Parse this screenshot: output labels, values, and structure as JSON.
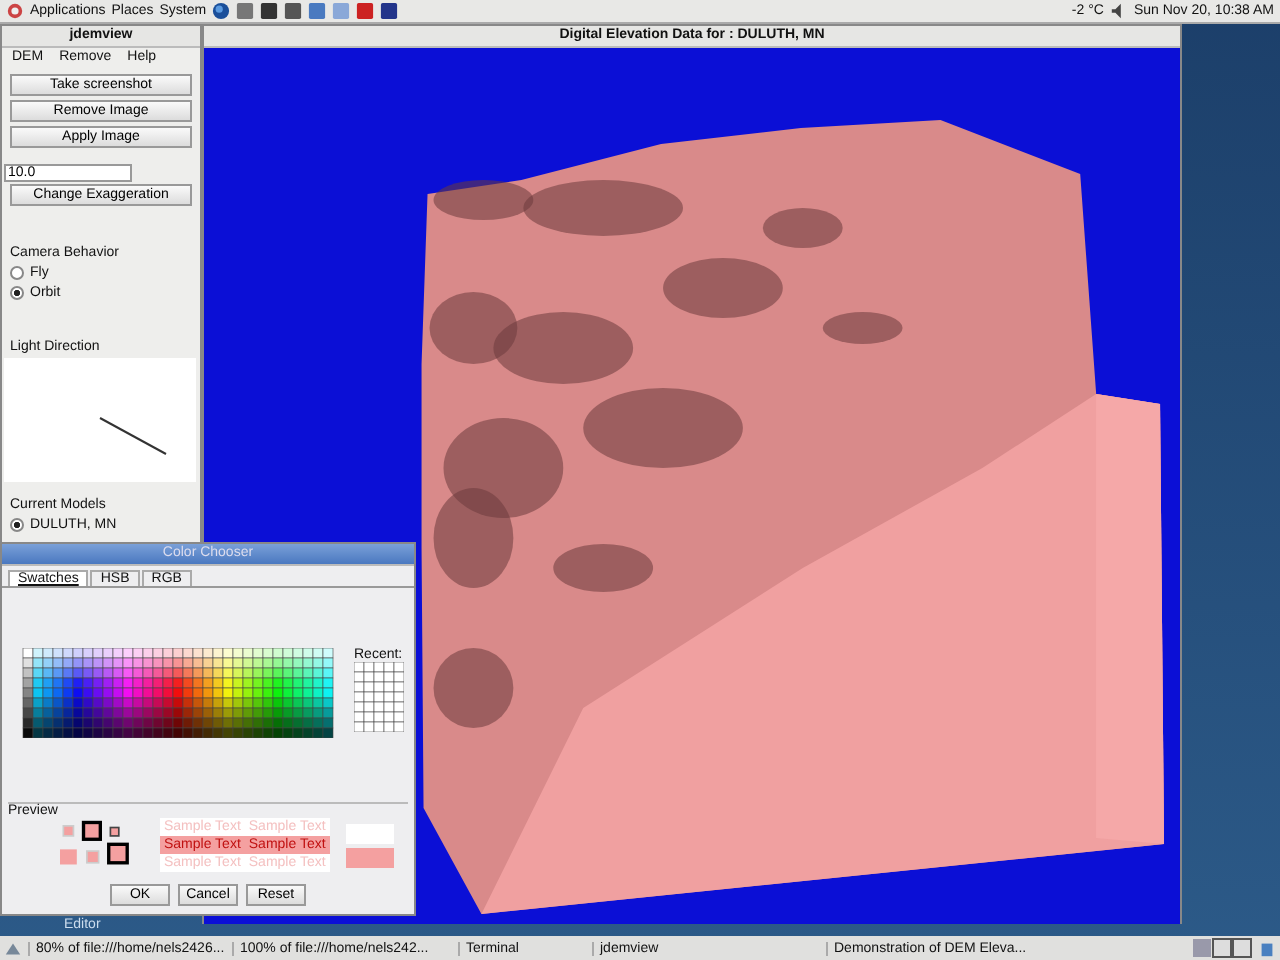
{
  "top_panel": {
    "menus": [
      "Applications",
      "Places",
      "System"
    ],
    "weather": "-2 °C",
    "clock": "Sun Nov 20, 10:38 AM"
  },
  "control_window": {
    "title": "jdemview",
    "menus": [
      "DEM",
      "Remove",
      "Help"
    ],
    "buttons": [
      "Take screenshot",
      "Remove Image",
      "Apply Image"
    ],
    "exaggeration_field": {
      "value": "10.0"
    },
    "exaggeration_button": "Change Exaggeration",
    "camera": {
      "label": "Camera Behavior",
      "options": [
        {
          "label": "Fly",
          "selected": false
        },
        {
          "label": "Orbit",
          "selected": true
        }
      ]
    },
    "light": {
      "label": "Light Direction"
    },
    "models": {
      "label": "Current Models",
      "options": [
        {
          "label": "DULUTH, MN",
          "selected": true
        }
      ]
    }
  },
  "viewer_window": {
    "title": "Digital Elevation Data for : DULUTH, MN"
  },
  "color_chooser": {
    "title": "Color Chooser",
    "tabs": [
      {
        "label": "Swatches",
        "selected": true
      },
      {
        "label": "HSB",
        "selected": false
      },
      {
        "label": "RGB",
        "selected": false
      }
    ],
    "recent_label": "Recent:",
    "preview_label": "Preview",
    "samples": [
      {
        "kind": "light",
        "texts": [
          "Sample Text",
          "Sample Text"
        ]
      },
      {
        "kind": "filled",
        "texts": [
          "Sample Text",
          "Sample Text"
        ]
      },
      {
        "kind": "light",
        "texts": [
          "Sample Text",
          "Sample Text"
        ]
      }
    ],
    "buttons": [
      "OK",
      "Cancel",
      "Reset"
    ]
  },
  "desktop_icon": {
    "label": "Editor"
  },
  "taskbar": {
    "items": [
      "80% of file:///home/nels2426...",
      "100% of file:///home/nels242...",
      "Terminal",
      "jdemview",
      "Demonstration of DEM Eleva..."
    ]
  }
}
